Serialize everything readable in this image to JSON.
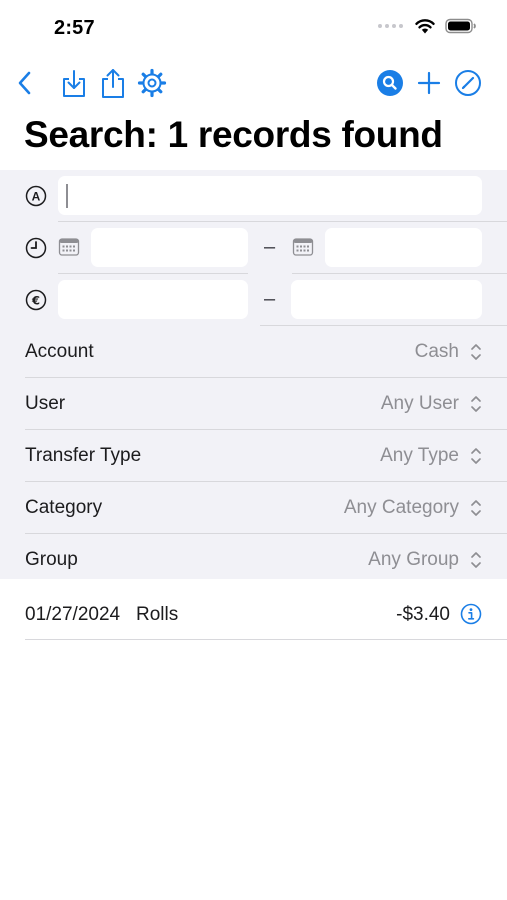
{
  "status_bar": {
    "time": "2:57"
  },
  "navbar": {
    "icons": [
      "chevron-left-icon",
      "import-icon",
      "share-icon",
      "gear-icon",
      "search-filled-icon",
      "plus-icon",
      "compose-icon"
    ],
    "accent_color": "#1a7ee6"
  },
  "title": "Search: 1 records found",
  "search_form": {
    "text_field": {
      "icon": "a-circle-icon",
      "value": ""
    },
    "date_range": {
      "icon": "clock-icon",
      "from": "",
      "to": "",
      "separator": "–"
    },
    "amount_range": {
      "icon": "euro-circle-icon",
      "from": "",
      "to": "",
      "separator": "–"
    },
    "pickers": [
      {
        "label": "Account",
        "value": "Cash"
      },
      {
        "label": "User",
        "value": "Any User"
      },
      {
        "label": "Transfer Type",
        "value": "Any Type"
      },
      {
        "label": "Category",
        "value": "Any Category"
      },
      {
        "label": "Group",
        "value": "Any Group"
      }
    ]
  },
  "results": [
    {
      "date": "01/27/2024",
      "description": "Rolls",
      "amount": "-$3.40"
    }
  ]
}
